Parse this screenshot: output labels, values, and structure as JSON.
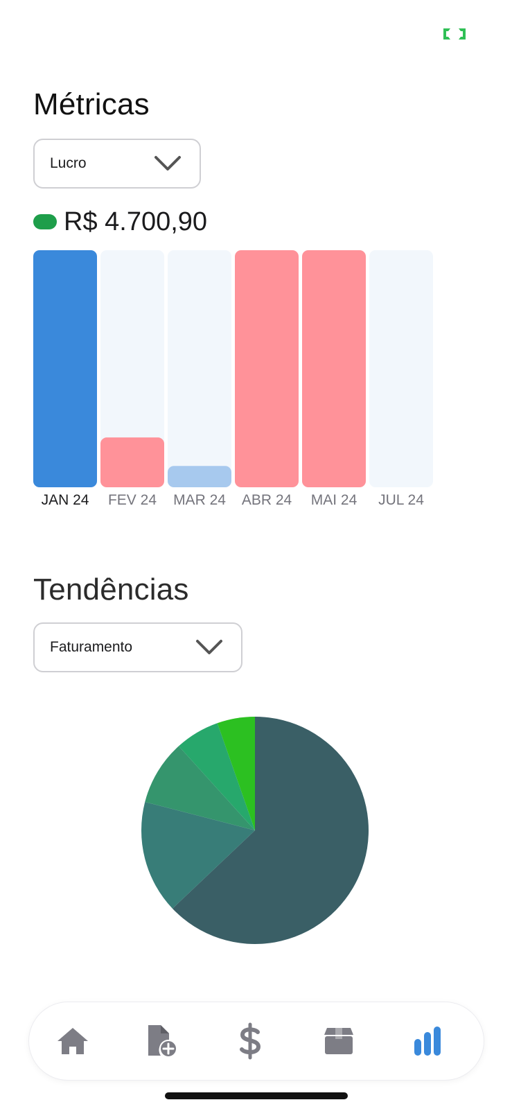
{
  "colors": {
    "accent_blue": "#3a89db",
    "negative_red": "#ff9299",
    "light_blue": "#a7c9ee",
    "track": "#f2f7fc",
    "indicator_green": "#1e9e4a",
    "tab_inactive": "#7d7d85"
  },
  "metrics": {
    "title": "Métricas",
    "select_value": "Lucro",
    "value": "R$ 4.700,90",
    "indicator_color": "#1e9e4a"
  },
  "chart_data": [
    {
      "type": "bar",
      "categories": [
        "JAN 24",
        "FEV 24",
        "MAR 24",
        "ABR 24",
        "MAI 24",
        "JUL 24"
      ],
      "values": [
        1.0,
        0.21,
        0.09,
        1.0,
        1.0,
        0
      ],
      "bar_colors": [
        "#3a89db",
        "#ff9299",
        "#a7c9ee",
        "#ff9299",
        "#ff9299",
        "#f2f7fc"
      ],
      "selected_index": 0,
      "ylim": [
        0,
        1
      ],
      "title": "",
      "xlabel": "",
      "ylabel": ""
    },
    {
      "type": "pie",
      "values": [
        64.5,
        16.5,
        9.5,
        6.5,
        5.5
      ],
      "colors": [
        "#3a5f66",
        "#387d78",
        "#35956d",
        "#27a86c",
        "#2cc021"
      ],
      "title": ""
    }
  ],
  "trends": {
    "title": "Tendências",
    "select_value": "Faturamento"
  },
  "tabbar": {
    "items": [
      {
        "icon": "home-icon",
        "active": false
      },
      {
        "icon": "add-document-icon",
        "active": false
      },
      {
        "icon": "dollar-icon",
        "active": false
      },
      {
        "icon": "box-icon",
        "active": false
      },
      {
        "icon": "bar-chart-icon",
        "active": true
      }
    ]
  }
}
